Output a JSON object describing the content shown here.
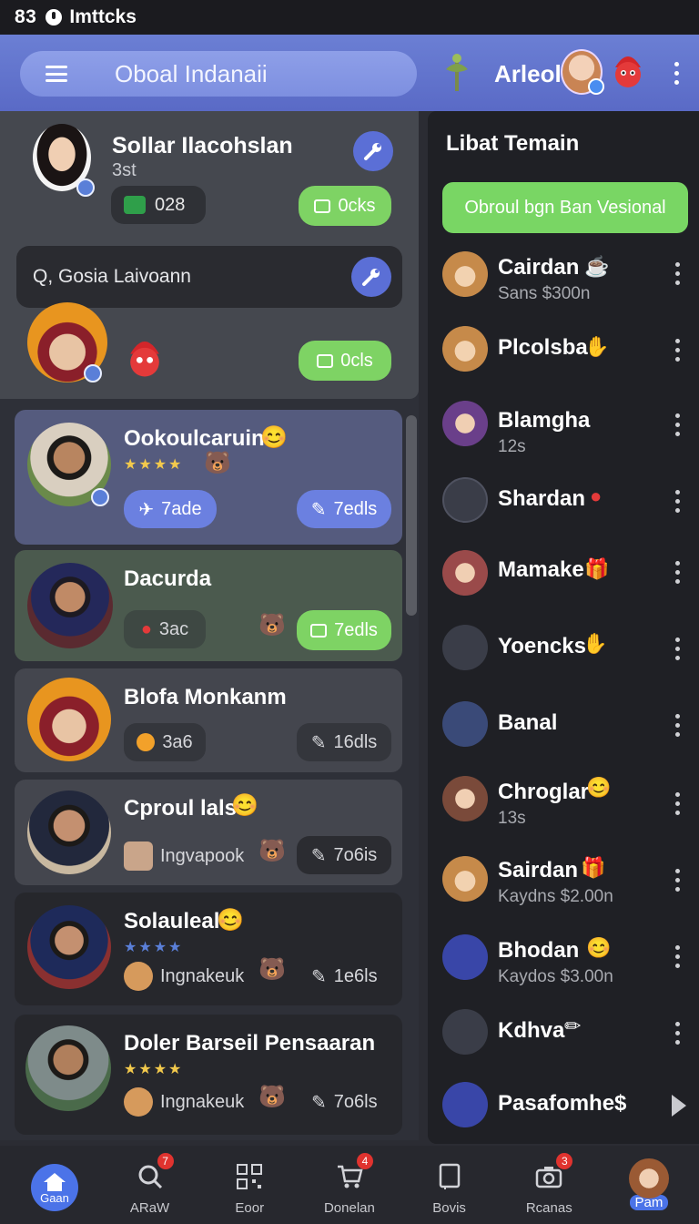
{
  "status_bar": {
    "time": "83",
    "app": "Imttcks"
  },
  "header": {
    "title": "Oboal Indanaii",
    "user_name": "Arleol"
  },
  "left": {
    "top_card": {
      "name": "Sollar Ilacohslan",
      "sub": "3st",
      "chip_value": "028",
      "button_label": "0cks"
    },
    "search": {
      "placeholder": "Q, Gosia Laivoann"
    },
    "second_button_label": "0cls",
    "items": [
      {
        "name": "Ookoulcaruin",
        "stars": "★★★★",
        "left_label": "7ade",
        "right_label": "7edls"
      },
      {
        "name": "Dacurda",
        "left_label": "3ac",
        "right_label": "7edls"
      },
      {
        "name": "Blofa Monkanm",
        "left_label": "3a6",
        "right_label": "16dls"
      },
      {
        "name": "Cproul lals",
        "left_label": "Ingvapook",
        "right_label": "7o6is"
      },
      {
        "name": "Solauleal",
        "stars": "★★★★",
        "left_label": "Ingnakeuk",
        "right_label": "1e6ls"
      },
      {
        "name": "Doler Barseil Pensaaran",
        "stars": "★★★★",
        "left_label": "Ingnakeuk",
        "right_label": "7o6ls"
      }
    ]
  },
  "right": {
    "title": "Libat Temain",
    "green_button": "Obroul bgn Ban Vesional",
    "contacts": [
      {
        "name": "Cairdan",
        "sub": "Sans  $300n"
      },
      {
        "name": "Plcolsba",
        "sub": ""
      },
      {
        "name": "Blamgha",
        "sub": "12s"
      },
      {
        "name": "Shardan",
        "sub": ""
      },
      {
        "name": "Mamake",
        "sub": ""
      },
      {
        "name": "Yoencks",
        "sub": ""
      },
      {
        "name": "Banal",
        "sub": ""
      },
      {
        "name": "Chroglar",
        "sub": "13s"
      },
      {
        "name": "Sairdan",
        "sub": "Kaydns  $2.00n"
      },
      {
        "name": "Bhodan",
        "sub": "Kaydos  $3.00n"
      },
      {
        "name": "Kdhva",
        "sub": ""
      },
      {
        "name": "Pasafomhe$",
        "sub": ""
      }
    ]
  },
  "bottom_nav": [
    {
      "label": "Gaan",
      "icon": "home-icon"
    },
    {
      "label": "ARaW",
      "icon": "search-icon",
      "badge": "7"
    },
    {
      "label": "Eoor",
      "icon": "qr-icon"
    },
    {
      "label": "Donelan",
      "icon": "cart-icon",
      "badge": "4"
    },
    {
      "label": "Bovis",
      "icon": "book-icon"
    },
    {
      "label": "Rcanas",
      "icon": "camera-icon",
      "badge": "3"
    },
    {
      "label": "Pam",
      "icon": "profile-avatar"
    }
  ],
  "colors": {
    "accent": "#5b6fd6",
    "green": "#7ed364",
    "header": "#6b7fd4",
    "background": "#2b2c33"
  }
}
